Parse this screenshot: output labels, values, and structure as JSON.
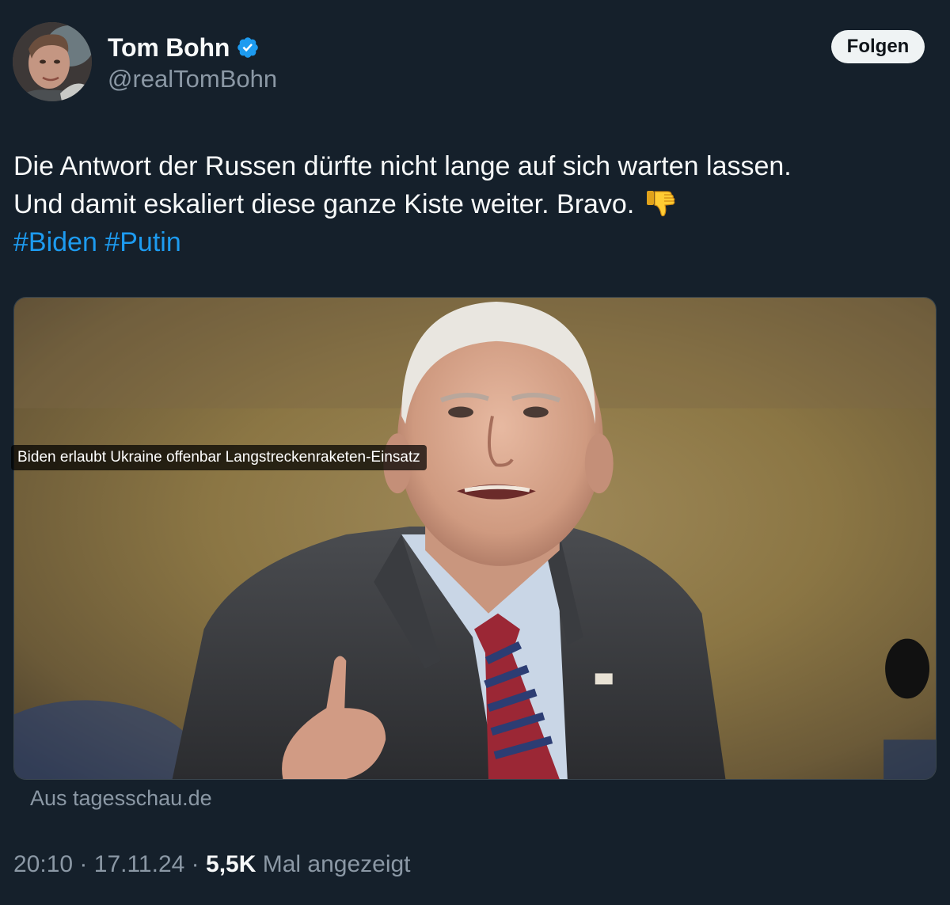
{
  "author": {
    "display_name": "Tom Bohn",
    "handle": "@realTomBohn",
    "verified": true,
    "verified_color": "#1d9bf0"
  },
  "follow_button": {
    "label": "Folgen"
  },
  "tweet": {
    "line1": "Die Antwort der Russen dürfte nicht lange auf sich warten lassen.",
    "line2": "Und damit eskaliert diese ganze Kiste weiter. Bravo.",
    "emoji": "thumbs-down",
    "hashtags": [
      "#Biden",
      "#Putin"
    ]
  },
  "card": {
    "headline": "Biden erlaubt Ukraine offenbar Langstreckenraketen-Einsatz",
    "source": "Aus tagesschau.de"
  },
  "meta": {
    "time": "20:10",
    "date": "17.11.24",
    "separator": "·",
    "views_count": "5,5K",
    "views_label": "Mal angezeigt"
  },
  "colors": {
    "background": "#15202b",
    "link": "#1d9bf0",
    "secondary_text": "#8b98a5",
    "primary_text": "#f7f9f9"
  }
}
